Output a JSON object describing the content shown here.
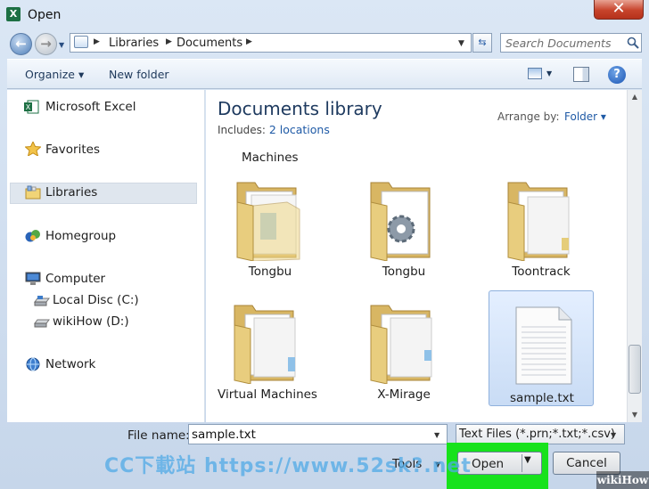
{
  "window": {
    "title": "Open",
    "close_glyph": "✕"
  },
  "address": {
    "crumbs": [
      "Libraries",
      "Documents"
    ]
  },
  "search": {
    "placeholder": "Search Documents"
  },
  "toolbar": {
    "organize": "Organize ▾",
    "new_folder": "New folder",
    "help": "?"
  },
  "sidebar": {
    "items": [
      {
        "label": "Microsoft Excel"
      },
      {
        "label": "Favorites"
      },
      {
        "label": "Libraries",
        "selected": true
      },
      {
        "label": "Homegroup"
      },
      {
        "label": "Computer"
      },
      {
        "label": "Local Disc (C:)"
      },
      {
        "label": "wikiHow (D:)"
      },
      {
        "label": "Network"
      }
    ]
  },
  "library": {
    "title": "Documents library",
    "includes_label": "Includes:",
    "locations": "2 locations",
    "arrange_label": "Arrange by:",
    "arrange_value": "Folder ▾"
  },
  "files": {
    "partial_label": "Machines",
    "items": [
      {
        "label": "Tongbu",
        "type": "folder"
      },
      {
        "label": "Tongbu",
        "type": "folder-gear"
      },
      {
        "label": "Toontrack",
        "type": "folder"
      },
      {
        "label": "Virtual Machines",
        "type": "folder"
      },
      {
        "label": "X-Mirage",
        "type": "folder"
      },
      {
        "label": "sample.txt",
        "type": "text-file",
        "selected": true
      }
    ]
  },
  "bottom": {
    "file_name_label": "File name:",
    "file_name_value": "sample.txt",
    "file_type": "Text Files (*.prn;*.txt;*.csv)",
    "tools": "Tools",
    "open": "Open",
    "cancel": "Cancel"
  },
  "overlays": {
    "watermark": "CC下載站 https://www.52sk?.net",
    "brand": "wikiHow"
  },
  "colors": {
    "highlight": "#17e21c",
    "link": "#1f5aa6",
    "selection": "#c9dcf5"
  }
}
